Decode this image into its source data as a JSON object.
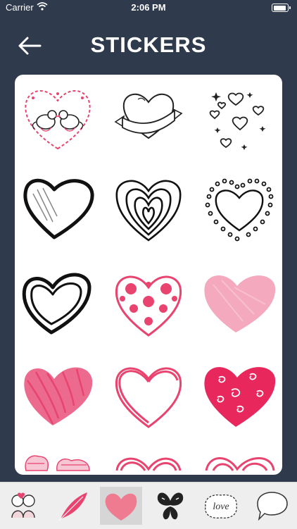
{
  "status_bar": {
    "carrier": "Carrier",
    "time": "2:06 PM"
  },
  "header": {
    "title": "STICKERS",
    "back_icon": "arrow-left-icon"
  },
  "colors": {
    "background": "#2f3a4c",
    "panel": "#ffffff",
    "tab_bar": "#eeeeee",
    "pink": "#e8446f",
    "light_pink": "#f4a9bf"
  },
  "stickers": [
    {
      "name": "sticker-birds-heart-wreath",
      "icon": "love-birds-heart-icon"
    },
    {
      "name": "sticker-heart-banner",
      "icon": "heart-ribbon-icon"
    },
    {
      "name": "sticker-scattered-hearts",
      "icon": "small-hearts-icon"
    },
    {
      "name": "sticker-sketch-heart-black",
      "icon": "sketch-heart-icon"
    },
    {
      "name": "sticker-layered-heart",
      "icon": "layered-heart-icon"
    },
    {
      "name": "sticker-dotted-heart",
      "icon": "dotted-heart-icon"
    },
    {
      "name": "sticker-double-outline-heart",
      "icon": "outline-heart-icon"
    },
    {
      "name": "sticker-polka-dot-heart",
      "icon": "polka-heart-icon"
    },
    {
      "name": "sticker-pink-chalk-heart",
      "icon": "chalk-heart-icon"
    },
    {
      "name": "sticker-pink-scribble-heart",
      "icon": "scribble-heart-icon"
    },
    {
      "name": "sticker-pink-outline-heart",
      "icon": "pink-outline-heart-icon"
    },
    {
      "name": "sticker-pink-swirl-heart",
      "icon": "swirl-heart-icon"
    },
    {
      "name": "sticker-pink-pattern-heart",
      "icon": "pattern-heart-icon"
    },
    {
      "name": "sticker-pink-loop-heart",
      "icon": "loop-heart-icon"
    },
    {
      "name": "sticker-pink-doodle-heart",
      "icon": "doodle-heart-icon"
    }
  ],
  "tabs": [
    {
      "name": "tab-couple",
      "icon": "couple-icon",
      "active": false
    },
    {
      "name": "tab-feather",
      "icon": "feather-icon",
      "active": false
    },
    {
      "name": "tab-heart",
      "icon": "heart-icon",
      "active": true
    },
    {
      "name": "tab-butterfly",
      "icon": "butterfly-icon",
      "active": false
    },
    {
      "name": "tab-love-text",
      "icon": "love-word-icon",
      "text": "love",
      "active": false
    },
    {
      "name": "tab-speech-bubble",
      "icon": "speech-bubble-icon",
      "active": false
    }
  ]
}
